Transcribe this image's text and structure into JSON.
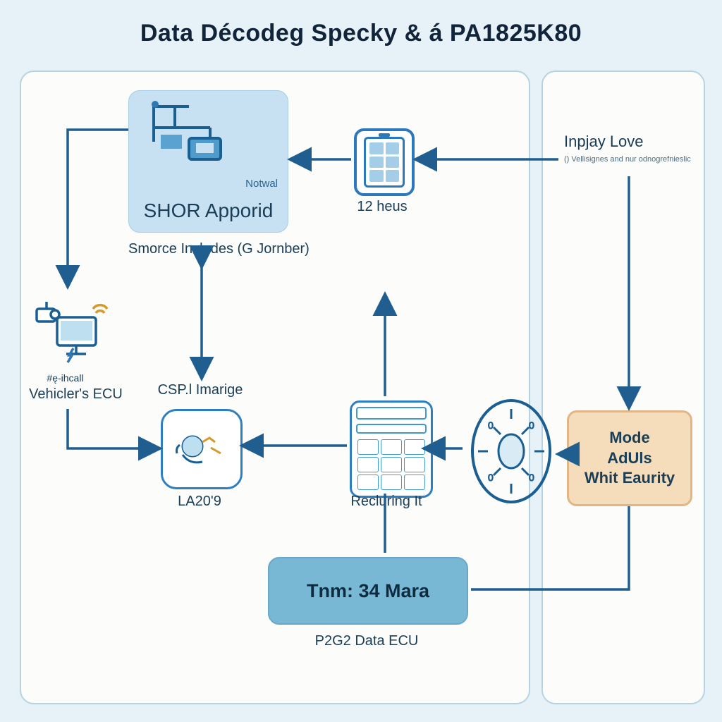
{
  "title": "Data Décodeg Specky & á PA1825K80",
  "shor": {
    "tag": "Notwal",
    "title": "SHOR Apporid",
    "subtitle": "Smorce Includes (G Jornber)"
  },
  "battery": {
    "label": "12 heus"
  },
  "inpjay": {
    "title": "Inpjay Love",
    "sub": "() Vellisignes and nur odnogrefnieslic"
  },
  "ecu": {
    "pre": "#ę-ihcall",
    "label": "Vehicler's ECU"
  },
  "csp": {
    "label": "CSP.l Imarige"
  },
  "la209": {
    "label": "LA20'9"
  },
  "reclur": {
    "label": "Recluring It"
  },
  "mode": {
    "l1": "Mode",
    "l2": "AdUls",
    "l3": "Whit Eaurity"
  },
  "trim": {
    "label": "Tnm: 34 Mara"
  },
  "p2g2": {
    "label": "P2G2 Data ECU"
  },
  "colors": {
    "arrow": "#1f5e8f"
  }
}
